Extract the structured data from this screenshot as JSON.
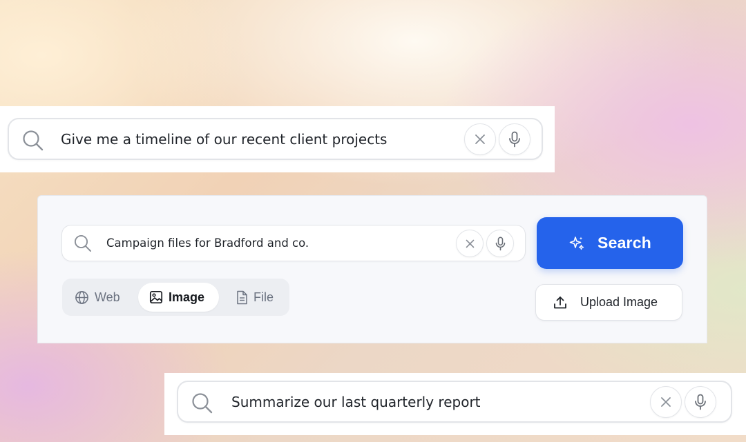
{
  "top_search": {
    "query": "Give me a timeline of our recent client projects"
  },
  "main_search": {
    "query": "Campaign files for Bradford and co.",
    "search_button_label": "Search",
    "upload_button_label": "Upload Image",
    "tabs": [
      {
        "label": "Web",
        "icon": "globe-icon",
        "active": false
      },
      {
        "label": "Image",
        "icon": "image-icon",
        "active": true
      },
      {
        "label": "File",
        "icon": "file-icon",
        "active": false
      }
    ]
  },
  "bottom_search": {
    "query": "Summarize our last quarterly report"
  },
  "colors": {
    "accent": "#2563eb",
    "text": "#1f2329",
    "muted": "#6b7280",
    "border": "#e2e4e8"
  }
}
